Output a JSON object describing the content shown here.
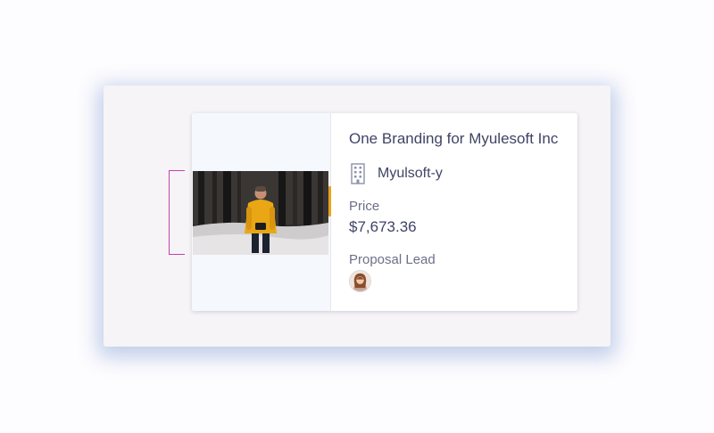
{
  "card": {
    "title": "One Branding for Myulesoft Inc",
    "company": "Myulsoft-y",
    "price_label": "Price",
    "price_value": "$7,673.36",
    "lead_label": "Proposal Lead"
  },
  "icons": {
    "company": "building-icon",
    "lock": "lock-icon",
    "avatar": "proposal-lead-avatar"
  },
  "colors": {
    "accent": "#e8a21a",
    "bracket": "#c63fa9",
    "text_primary": "#3f4466",
    "text_secondary": "#6c7088",
    "lock": "#2e6e9c"
  }
}
